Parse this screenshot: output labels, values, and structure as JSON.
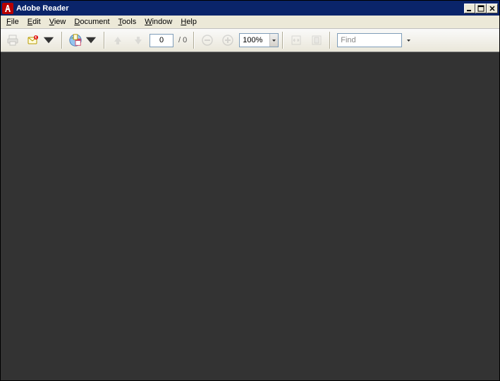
{
  "titlebar": {
    "title": "Adobe Reader"
  },
  "menubar": {
    "file": {
      "u": "F",
      "rest": "ile"
    },
    "edit": {
      "u": "E",
      "rest": "dit"
    },
    "view": {
      "u": "V",
      "rest": "iew"
    },
    "document": {
      "u": "D",
      "rest": "ocument"
    },
    "tools": {
      "u": "T",
      "rest": "ools"
    },
    "window": {
      "u": "W",
      "rest": "indow"
    },
    "help": {
      "u": "H",
      "rest": "elp"
    }
  },
  "toolbar": {
    "page_current": "0",
    "page_total": "0",
    "zoom_value": "100%",
    "find_placeholder": "Find"
  }
}
